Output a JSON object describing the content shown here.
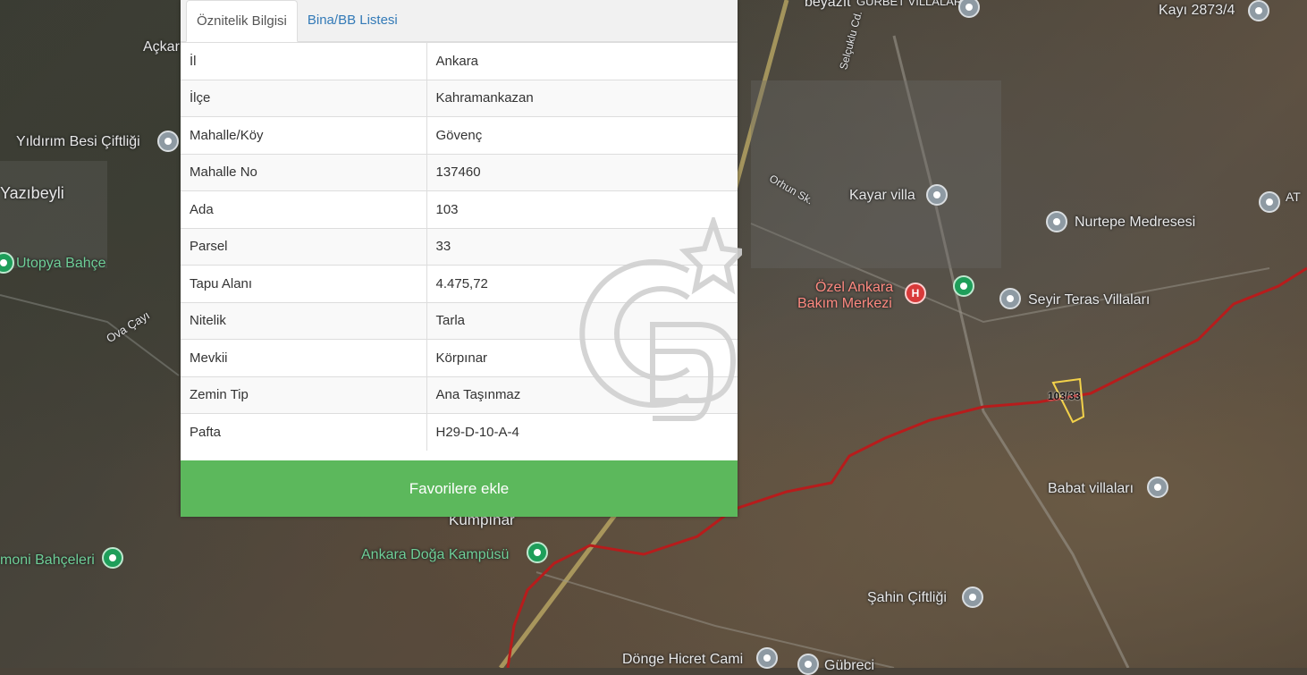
{
  "tabs": [
    {
      "label": "Öznitelik Bilgisi",
      "active": true
    },
    {
      "label": "Bina/BB Listesi",
      "active": false
    }
  ],
  "attributes": [
    {
      "key": "İl",
      "value": "Ankara"
    },
    {
      "key": "İlçe",
      "value": "Kahramankazan"
    },
    {
      "key": "Mahalle/Köy",
      "value": "Gövenç"
    },
    {
      "key": "Mahalle No",
      "value": "137460"
    },
    {
      "key": "Ada",
      "value": "103"
    },
    {
      "key": "Parsel",
      "value": "33"
    },
    {
      "key": "Tapu Alanı",
      "value": "4.475,72"
    },
    {
      "key": "Nitelik",
      "value": "Tarla"
    },
    {
      "key": "Mevkii",
      "value": "Körpınar"
    },
    {
      "key": "Zemin Tip",
      "value": "Ana Taşınmaz"
    },
    {
      "key": "Pafta",
      "value": "H29-D-10-A-4"
    }
  ],
  "favorite_button": "Favorilere ekle",
  "map_labels": {
    "beyazit": "beyazıt",
    "gurbet": "GURBET VİLLALARI",
    "kayi": "Kayı 2873/4",
    "ackar": "Açkar",
    "yildirim": "Yıldırım Besi Çiftliği",
    "yazibeyli": "Yazıbeyli",
    "utopya": "Utopya Bahçe",
    "ova": "Ova Çayı",
    "selcuklu": "Selçuklu Cd.",
    "orhun": "Orhun Sk.",
    "kayar": "Kayar villa",
    "nurtepe": "Nurtepe Medresesi",
    "at": "AT",
    "ozel": "Özel Ankara",
    "bakim": "Bakım Merkezi",
    "seyir": "Seyir Teras Villaları",
    "parcel": "103/33",
    "babat": "Babat villaları",
    "kumpinar": "Kumpınar",
    "moni": "moni Bahçeleri",
    "doga": "Ankara Doğa Kampüsü",
    "sahin": "Şahin Çiftliği",
    "donge": "Dönge Hicret Cami",
    "gubreci": "Gübreci"
  },
  "colors": {
    "tab_link": "#337ab7",
    "button": "#5cb85c",
    "boundary": "#b71c1c",
    "parcel": "#f2d14a"
  }
}
